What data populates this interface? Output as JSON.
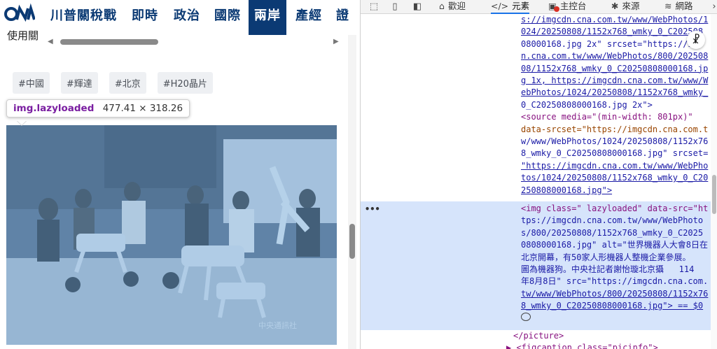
{
  "page": {
    "logo_text": "CNA",
    "nav": [
      "川普關稅戰",
      "即時",
      "政治",
      "國際",
      "兩岸",
      "產經",
      "證"
    ],
    "nav_active_index": 4,
    "cut_text": "使用關",
    "tags": [
      "#中國",
      "#輝達",
      "#北京",
      "#H20晶片"
    ],
    "tooltip": {
      "name": "img.lazyloaded",
      "size": "477.41 × 318.26"
    },
    "photo_watermark": "中央通訊社"
  },
  "devtools": {
    "tabs": [
      {
        "label": "歡迎",
        "icon": "home-icon",
        "glyph": "⌂"
      },
      {
        "label": "元素",
        "icon": "code-icon",
        "glyph": "</>"
      },
      {
        "label": "主控台",
        "icon": "console-icon",
        "glyph": "▣"
      },
      {
        "label": "來源",
        "icon": "bug-icon",
        "glyph": "✱"
      },
      {
        "label": "網路",
        "icon": "wifi-icon",
        "glyph": "≋"
      }
    ],
    "active_tab_index": 1,
    "dots": "•••",
    "lines": [
      "s://imgcdn.cna.com.tw/www/WebPhotos/1",
      "024/20250808/1152x768_wmky_0_C202508",
      "08000168.jpg 2x\" srcset=\"https://im",
      "n.cna.com.tw/www/WebPhotos/800/202508",
      "08/1152x768_wmky_0_C20250808000168.jp",
      "g 1x, https://imgcdn.cna.com.tw/www/W",
      "ebPhotos/1024/20250808/1152x768_wmky_",
      "0_C20250808000168.jpg 2x\">",
      "<source media=\"(min-width: 801px)\"",
      "data-srcset=\"https://imgcdn.cna.com.t",
      "w/www/WebPhotos/1024/20250808/1152x76",
      "8_wmky_0_C20250808000168.jpg\" srcset=",
      "\"https://imgcdn.cna.com.tw/www/WebPho",
      "tos/1024/20250808/1152x768_wmky_0_C20",
      "250808000168.jpg\">",
      "<img class=\" lazyloaded\" data-src=\"ht",
      "tps://imgcdn.cna.com.tw/www/WebPhoto",
      "s/800/20250808/1152x768_wmky_0_C2025",
      "0808000168.jpg\" alt=\"世界機器人大會8日在",
      "北京開幕，有50家人形機器人整機企業參展。",
      "圖為機器狗。中央社記者謝怡璇北京攝   114",
      "年8月8日\" src=\"https://imgcdn.cna.com.",
      "tw/www/WebPhotos/800/20250808/1152x76",
      "8_wmky_0_C20250808000168.jpg\"> == $0",
      "",
      "</picture>",
      "▶ <figcaption class=\"picinfo\">"
    ]
  }
}
